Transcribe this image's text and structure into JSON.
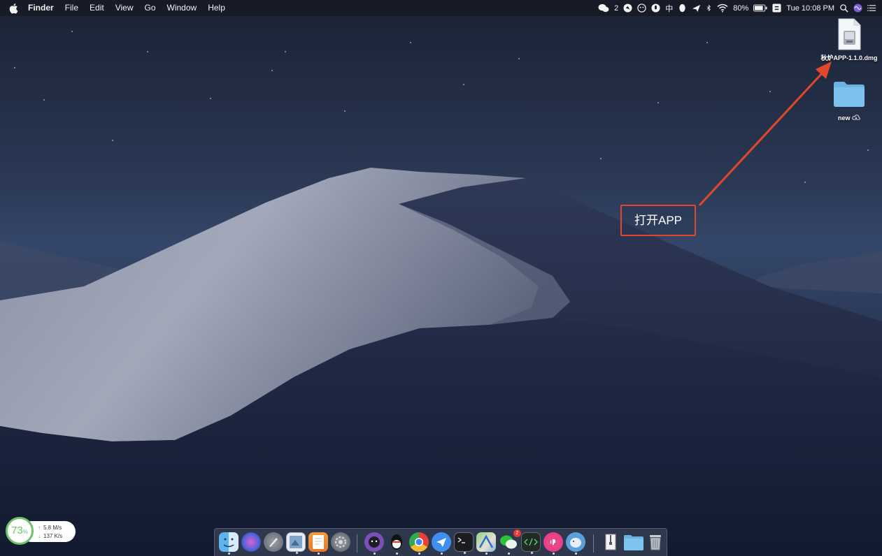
{
  "menubar": {
    "app_name": "Finder",
    "menus": [
      "File",
      "Edit",
      "View",
      "Go",
      "Window",
      "Help"
    ],
    "status": {
      "wechat_count": "2",
      "input_method": "中",
      "battery_percent": "80%",
      "datetime": "Tue 10:08 PM"
    }
  },
  "desktop_items": [
    {
      "label": "秋炉APP-1.1.0.dmg",
      "icon": "disk-image-icon"
    },
    {
      "label": "new",
      "icon": "folder-icon",
      "cloud_icon": "icloud-download-icon"
    }
  ],
  "annotation": {
    "text": "打开APP",
    "color": "#e0472b"
  },
  "net_widget": {
    "cpu_percent": "73",
    "percent_sign": "%",
    "upload": "5.8 M/s",
    "download": "137 K/s",
    "accent_color": "#6bc46a"
  },
  "dock": {
    "items": [
      {
        "name": "finder-icon",
        "running": true
      },
      {
        "name": "siri-icon",
        "running": false
      },
      {
        "name": "launchpad-icon",
        "running": false
      },
      {
        "name": "preview-icon",
        "running": true
      },
      {
        "name": "pages-icon",
        "running": true
      },
      {
        "name": "system-preferences-icon",
        "running": false
      },
      {
        "name": "github-desktop-icon",
        "running": true
      },
      {
        "name": "qq-icon",
        "running": true
      },
      {
        "name": "chrome-icon",
        "running": true
      },
      {
        "name": "feishu-icon",
        "running": true
      },
      {
        "name": "terminal-icon",
        "running": true
      },
      {
        "name": "maps-icon",
        "running": true
      },
      {
        "name": "wechat-icon",
        "running": true,
        "badge": "2"
      },
      {
        "name": "code-editor-icon",
        "running": true
      },
      {
        "name": "itunes-icon",
        "running": true
      },
      {
        "name": "sequel-pro-icon",
        "running": true
      },
      {
        "name": "archive-utility-icon",
        "running": false
      },
      {
        "name": "downloads-folder-icon",
        "running": false
      },
      {
        "name": "trash-icon",
        "running": false
      }
    ]
  }
}
